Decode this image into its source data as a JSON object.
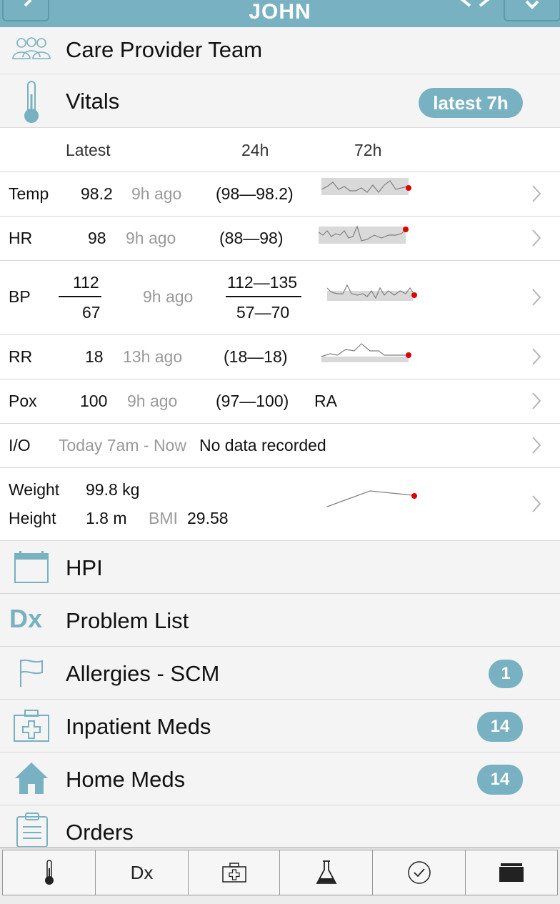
{
  "header": {
    "title": "JOHN"
  },
  "menu_top": {
    "care_team": "Care Provider Team",
    "vitals": "Vitals",
    "vitals_badge": "latest 7h"
  },
  "vitals": {
    "columns": {
      "latest": "Latest",
      "h24": "24h",
      "h72": "72h"
    },
    "temp": {
      "label": "Temp",
      "value": "98.2",
      "ago": "9h ago",
      "range": "(98—98.2)"
    },
    "hr": {
      "label": "HR",
      "value": "98",
      "ago": "9h ago",
      "range": "(88—98)"
    },
    "bp": {
      "label": "BP",
      "sys": "112",
      "dia": "67",
      "ago": "9h ago",
      "sys_range": "112—135",
      "dia_range": "57—70"
    },
    "rr": {
      "label": "RR",
      "value": "18",
      "ago": "13h ago",
      "range": "(18—18)"
    },
    "pox": {
      "label": "Pox",
      "value": "100",
      "ago": "9h ago",
      "range": "(97—100)",
      "extra": "RA"
    },
    "io": {
      "label": "I/O",
      "period": "Today 7am - Now",
      "status": "No data recorded"
    },
    "weight": {
      "label": "Weight",
      "value": "99.8 kg"
    },
    "height": {
      "label": "Height",
      "value": "1.8 m",
      "bmi_label": "BMI",
      "bmi_value": "29.58"
    }
  },
  "menu": {
    "hpi": "HPI",
    "problem_list": "Problem List",
    "dx_icon_text": "Dx",
    "allergies": "Allergies - SCM",
    "allergies_count": "1",
    "inpatient_meds": "Inpatient Meds",
    "inpatient_count": "14",
    "home_meds": "Home Meds",
    "home_count": "14",
    "orders": "Orders"
  },
  "tabbar": {
    "dx": "Dx"
  },
  "colors": {
    "accent": "#78b1c1",
    "sparkline": "#808080",
    "sparkband": "#d9d9d9",
    "latest_dot": "#e00000"
  }
}
